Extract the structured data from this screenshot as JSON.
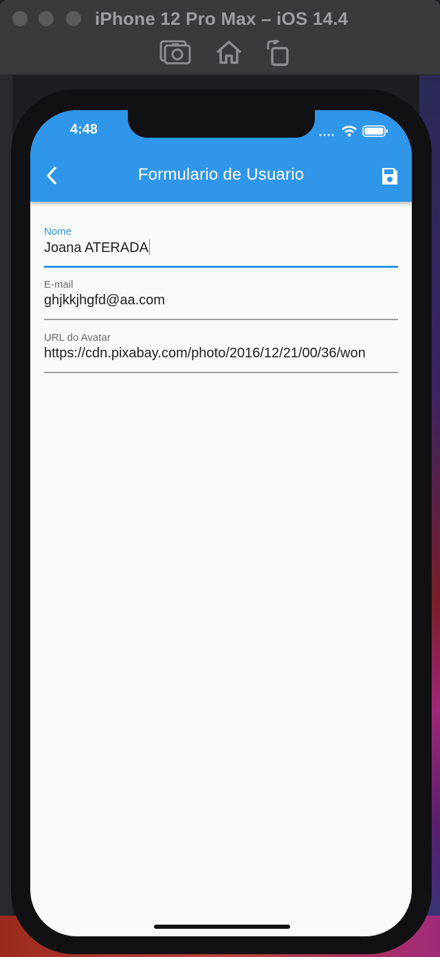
{
  "window": {
    "title": "iPhone 12 Pro Max – iOS 14.4",
    "toolbar_icons": [
      "screenshot-icon",
      "home-icon",
      "rotate-icon"
    ]
  },
  "status_bar": {
    "time": "4:48"
  },
  "app_bar": {
    "title": "Formulario de Usuario",
    "color": "#2f96ea"
  },
  "form": {
    "fields": [
      {
        "label": "Nome",
        "value": "Joana ATERADA"
      },
      {
        "label": "E-mail",
        "value": "ghjkkjhgfd@aa.com"
      },
      {
        "label": "URL do Avatar",
        "value": "https://cdn.pixabay.com/photo/2016/12/21/00/36/won"
      }
    ]
  }
}
